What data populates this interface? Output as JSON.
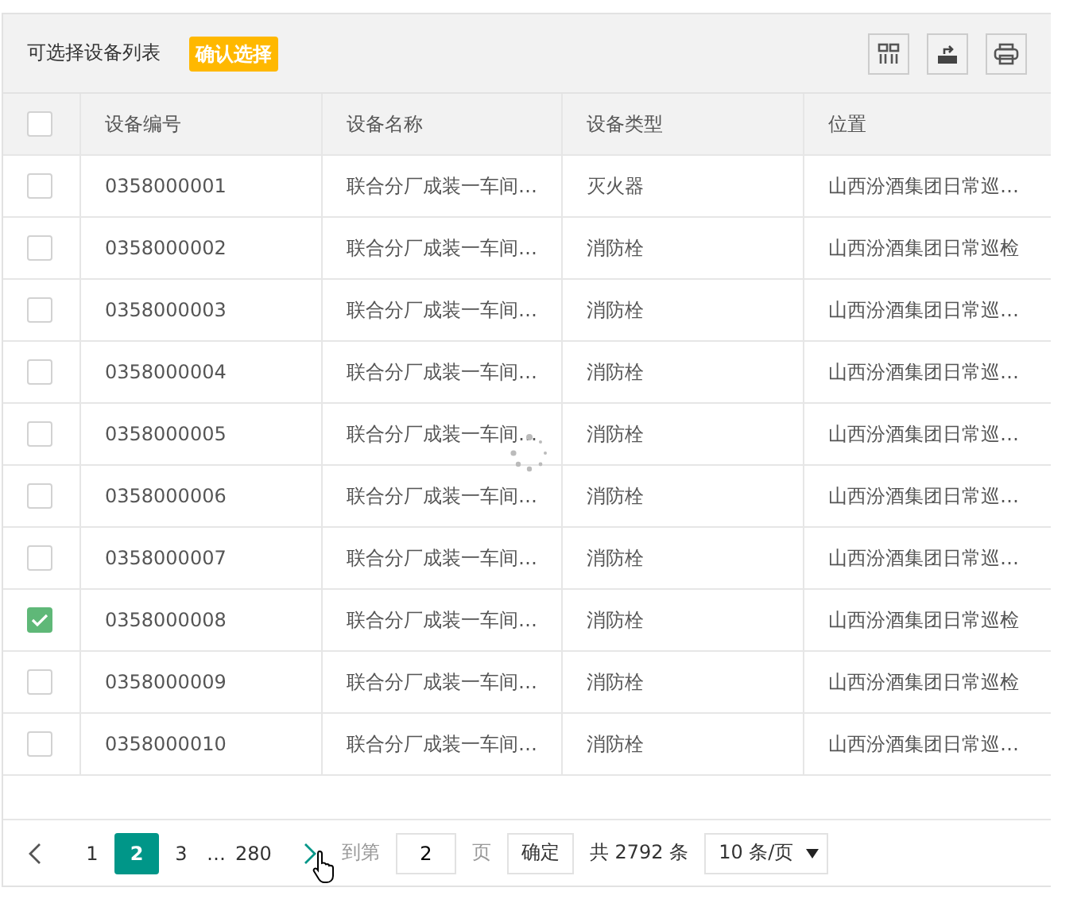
{
  "toolbar": {
    "title": "可选择设备列表",
    "confirm_button": "确认选择"
  },
  "table": {
    "all_checked": false,
    "columns": [
      "设备编号",
      "设备名称",
      "设备类型",
      "位置"
    ],
    "rows": [
      {
        "checked": false,
        "cells": [
          "0358000001",
          "联合分厂成装一车间…",
          "灭火器",
          "山西汾酒集团日常巡…"
        ]
      },
      {
        "checked": false,
        "cells": [
          "0358000002",
          "联合分厂成装一车间…",
          "消防栓",
          "山西汾酒集团日常巡检"
        ]
      },
      {
        "checked": false,
        "cells": [
          "0358000003",
          "联合分厂成装一车间…",
          "消防栓",
          "山西汾酒集团日常巡…"
        ]
      },
      {
        "checked": false,
        "cells": [
          "0358000004",
          "联合分厂成装一车间…",
          "消防栓",
          "山西汾酒集团日常巡…"
        ]
      },
      {
        "checked": false,
        "cells": [
          "0358000005",
          "联合分厂成装一车间…",
          "消防栓",
          "山西汾酒集团日常巡…"
        ]
      },
      {
        "checked": false,
        "cells": [
          "0358000006",
          "联合分厂成装一车间…",
          "消防栓",
          "山西汾酒集团日常巡…"
        ]
      },
      {
        "checked": false,
        "cells": [
          "0358000007",
          "联合分厂成装一车间…",
          "消防栓",
          "山西汾酒集团日常巡…"
        ]
      },
      {
        "checked": true,
        "cells": [
          "0358000008",
          "联合分厂成装一车间…",
          "消防栓",
          "山西汾酒集团日常巡检"
        ]
      },
      {
        "checked": false,
        "cells": [
          "0358000009",
          "联合分厂成装一车间…",
          "消防栓",
          "山西汾酒集团日常巡检"
        ]
      },
      {
        "checked": false,
        "cells": [
          "0358000010",
          "联合分厂成装一车间…",
          "消防栓",
          "山西汾酒集团日常巡…"
        ]
      }
    ]
  },
  "pagination": {
    "pages": [
      {
        "label": "1",
        "selected": false
      },
      {
        "label": "2",
        "selected": true
      },
      {
        "label": "3",
        "selected": false
      },
      {
        "label": "…",
        "kind": "ellipsis"
      },
      {
        "label": "280",
        "selected": false
      }
    ],
    "goto_label": "到第",
    "goto_value": "2",
    "page_label": "页",
    "confirm": "确定",
    "total": "共 2792 条",
    "page_size": "10 条/页"
  }
}
